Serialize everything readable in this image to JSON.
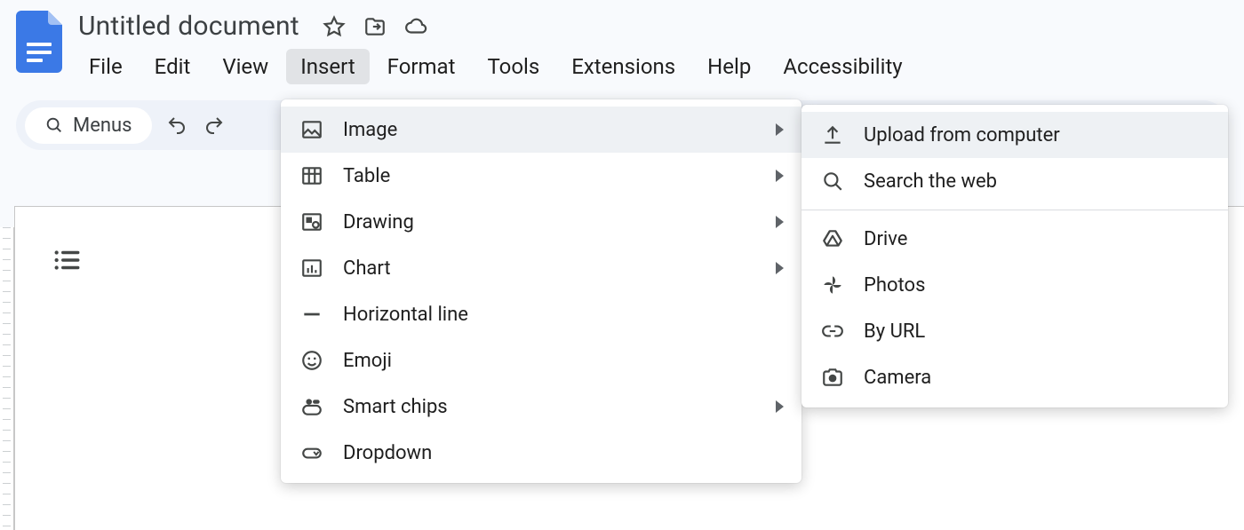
{
  "document": {
    "title": "Untitled document"
  },
  "menubar": {
    "file": "File",
    "edit": "Edit",
    "view": "View",
    "insert": "Insert",
    "format": "Format",
    "tools": "Tools",
    "extensions": "Extensions",
    "help": "Help",
    "accessibility": "Accessibility"
  },
  "toolbar": {
    "menus": "Menus"
  },
  "insertMenu": {
    "image": "Image",
    "table": "Table",
    "drawing": "Drawing",
    "chart": "Chart",
    "horizontal_line": "Horizontal line",
    "emoji": "Emoji",
    "smart_chips": "Smart chips",
    "dropdown": "Dropdown"
  },
  "imageMenu": {
    "upload": "Upload from computer",
    "search": "Search the web",
    "drive": "Drive",
    "photos": "Photos",
    "by_url": "By URL",
    "camera": "Camera"
  }
}
